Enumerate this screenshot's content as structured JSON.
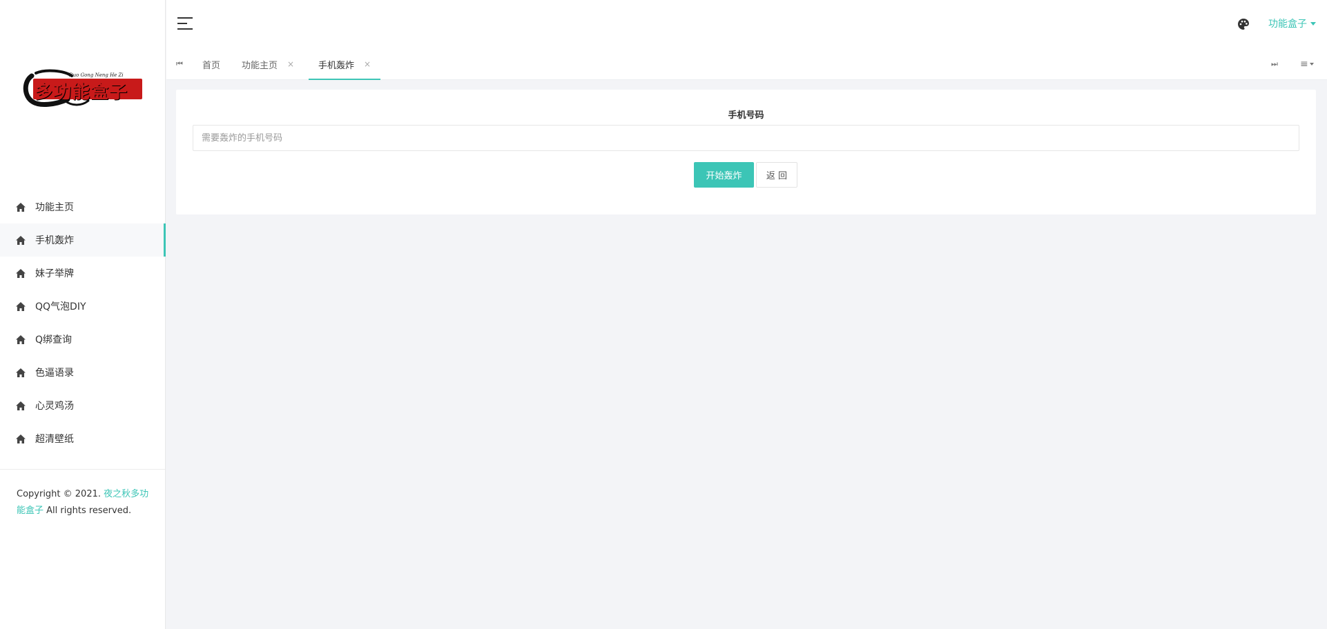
{
  "logo": {
    "text": "多功能盒子",
    "script_text": "Duo Gong Neng He Zi"
  },
  "sidebar": {
    "items": [
      {
        "label": "功能主页",
        "icon": "home-icon",
        "active": false
      },
      {
        "label": "手机轰炸",
        "icon": "home-icon",
        "active": true
      },
      {
        "label": "妹子举牌",
        "icon": "home-icon",
        "active": false
      },
      {
        "label": "QQ气泡DIY",
        "icon": "home-icon",
        "active": false
      },
      {
        "label": "Q绑查询",
        "icon": "home-icon",
        "active": false
      },
      {
        "label": "色逼语录",
        "icon": "home-icon",
        "active": false
      },
      {
        "label": "心灵鸡汤",
        "icon": "home-icon",
        "active": false
      },
      {
        "label": "超清壁纸",
        "icon": "home-icon",
        "active": false
      }
    ]
  },
  "footer": {
    "prefix": "Copyright © 2021.",
    "link": "夜之秋多功能盒子",
    "suffix": "All rights reserved."
  },
  "header": {
    "menu_icon": "hamburger-icon",
    "theme_icon": "palette-icon",
    "user_label": "功能盒子"
  },
  "tabs": {
    "first_icon": "skip-first-icon",
    "last_icon": "skip-last-icon",
    "menu_icon": "list-menu-icon",
    "items": [
      {
        "label": "首页",
        "closable": false,
        "active": false
      },
      {
        "label": "功能主页",
        "closable": true,
        "active": false
      },
      {
        "label": "手机轰炸",
        "closable": true,
        "active": true
      }
    ],
    "close_glyph": "×"
  },
  "form": {
    "label": "手机号码",
    "placeholder": "需要轰炸的手机号码",
    "value": "",
    "submit_label": "开始轰炸",
    "back_label": "返 回"
  },
  "colors": {
    "accent": "#3cc5b6",
    "background": "#f3f4f7",
    "panel": "#ffffff"
  }
}
